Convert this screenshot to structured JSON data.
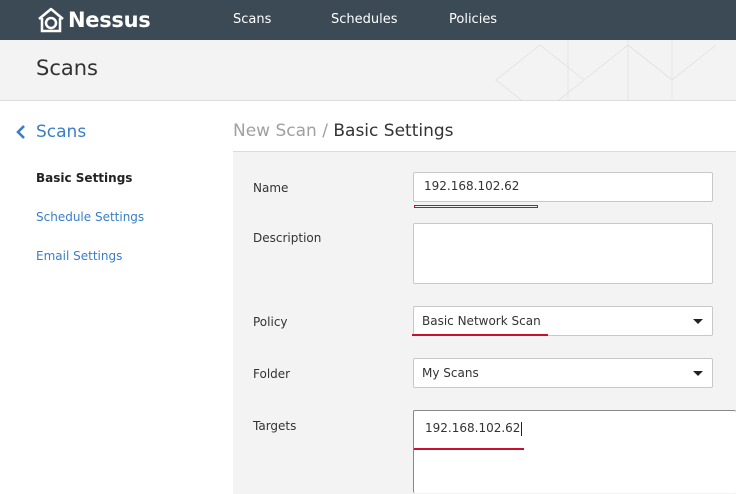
{
  "app": {
    "name": "Nessus"
  },
  "nav": {
    "scans": "Scans",
    "schedules": "Schedules",
    "policies": "Policies"
  },
  "header": {
    "title": "Scans"
  },
  "sidebar": {
    "back_label": "Scans",
    "items": [
      {
        "label": "Basic Settings",
        "active": true
      },
      {
        "label": "Schedule Settings",
        "active": false
      },
      {
        "label": "Email Settings",
        "active": false
      }
    ]
  },
  "breadcrumb": {
    "parent": "New Scan",
    "separator": " / ",
    "current": "Basic Settings"
  },
  "form": {
    "name": {
      "label": "Name",
      "value": "192.168.102.62"
    },
    "description": {
      "label": "Description",
      "value": ""
    },
    "policy": {
      "label": "Policy",
      "value": "Basic Network Scan"
    },
    "folder": {
      "label": "Folder",
      "value": "My Scans"
    },
    "targets": {
      "label": "Targets",
      "value": "192.168.102.62"
    }
  },
  "colors": {
    "topbar": "#3c4a56",
    "accent": "#3a7ec8",
    "annotation": "#c8102e"
  }
}
